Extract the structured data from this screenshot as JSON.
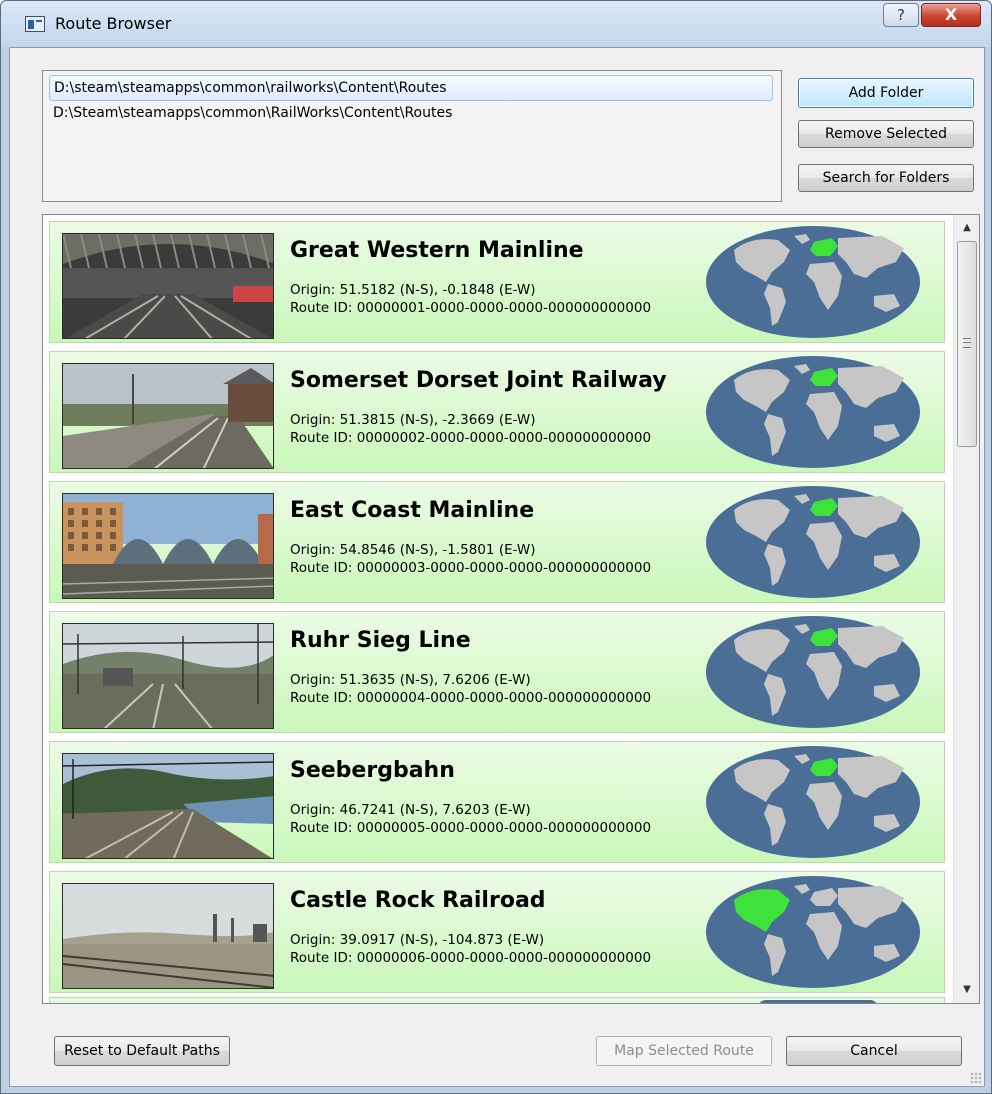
{
  "window": {
    "title": "Route Browser",
    "help_label": "?",
    "close_label": "X"
  },
  "folders": {
    "items": [
      {
        "path": "D:\\steam\\steamapps\\common\\railworks\\Content\\Routes",
        "selected": true
      },
      {
        "path": "D:\\Steam\\steamapps\\common\\RailWorks\\Content\\Routes",
        "selected": false
      }
    ]
  },
  "folder_buttons": {
    "add": "Add Folder",
    "remove": "Remove Selected",
    "search": "Search for Folders"
  },
  "routes": [
    {
      "name": "Great Western Mainline",
      "origin": "Origin: 51.5182 (N-S), -0.1848 (E-W)",
      "route_id": "Route ID: 00000001-0000-0000-0000-000000000000",
      "region": "europe",
      "thumb": "station"
    },
    {
      "name": "Somerset Dorset Joint Railway",
      "origin": "Origin: 51.3815 (N-S), -2.3669 (E-W)",
      "route_id": "Route ID: 00000002-0000-0000-0000-000000000000",
      "region": "europe",
      "thumb": "platform"
    },
    {
      "name": "East Coast Mainline",
      "origin": "Origin: 54.8546 (N-S), -1.5801 (E-W)",
      "route_id": "Route ID: 00000003-0000-0000-0000-000000000000",
      "region": "europe",
      "thumb": "arches"
    },
    {
      "name": "Ruhr Sieg Line",
      "origin": "Origin: 51.3635 (N-S), 7.6206 (E-W)",
      "route_id": "Route ID: 00000004-0000-0000-0000-000000000000",
      "region": "europe",
      "thumb": "catenary"
    },
    {
      "name": "Seebergbahn",
      "origin": "Origin: 46.7241 (N-S), 7.6203 (E-W)",
      "route_id": "Route ID: 00000005-0000-0000-0000-000000000000",
      "region": "europe",
      "thumb": "lake"
    },
    {
      "name": "Castle Rock Railroad",
      "origin": "Origin: 39.0917 (N-S), -104.873 (E-W)",
      "route_id": "Route ID: 00000006-0000-0000-0000-000000000000",
      "region": "north-america",
      "thumb": "plains"
    }
  ],
  "scrollbar": {
    "up_icon": "▲",
    "down_icon": "▼"
  },
  "footer_buttons": {
    "reset": "Reset to Default Paths",
    "map_selected": "Map Selected Route",
    "cancel": "Cancel"
  },
  "colors": {
    "ocean": "#4a6e96",
    "land": "#c6c6c6",
    "highlight": "#3fe23a",
    "card_top": "#ecfbe6",
    "card_bottom": "#c9f7b9"
  }
}
